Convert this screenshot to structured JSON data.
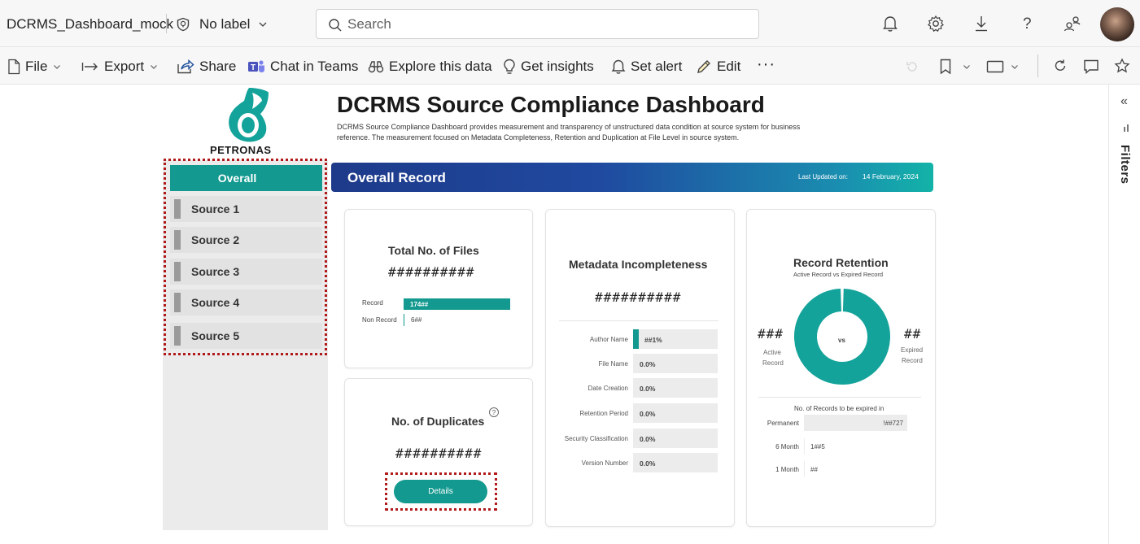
{
  "app": {
    "report_title": "DCRMS_Dashboard_mock",
    "sensitivity_label": "No label",
    "search_placeholder": "Search"
  },
  "toolbar": {
    "file": "File",
    "export": "Export",
    "share": "Share",
    "chat": "Chat in Teams",
    "explore": "Explore this data",
    "insights": "Get insights",
    "alert": "Set alert",
    "edit": "Edit",
    "more": "···"
  },
  "filters_pane": {
    "label": "Filters",
    "collapse_glyph": "«"
  },
  "brand": {
    "logo_text": "PETRONAS",
    "color": "#13998f"
  },
  "header": {
    "title": "DCRMS Source Compliance Dashboard",
    "description_1": "DCRMS Source Compliance Dashboard provides measurement and transparency of unstructured data condition at source system for business",
    "description_2": "reference. The measurement focused on Metadata Completeness, Retention and Duplication at File Level in source system."
  },
  "nav": {
    "items": [
      {
        "label": "Overall",
        "active": true
      },
      {
        "label": "Source 1",
        "active": false
      },
      {
        "label": "Source 2",
        "active": false
      },
      {
        "label": "Source 3",
        "active": false
      },
      {
        "label": "Source 4",
        "active": false
      },
      {
        "label": "Source 5",
        "active": false
      }
    ]
  },
  "banner": {
    "title": "Overall Record",
    "last_updated_label": "Last Updated on:",
    "last_updated_value": "14 February, 2024"
  },
  "total_files": {
    "title": "Total No. of Files",
    "value": "##########",
    "record_label": "Record",
    "record_value": "174##",
    "record_fraction": 0.96,
    "non_record_label": "Non Record",
    "non_record_value": "6##"
  },
  "duplicates": {
    "title": "No. of Duplicates",
    "value": "##########",
    "details_button": "Details",
    "help_glyph": "?"
  },
  "metadata": {
    "title": "Metadata Incompleteness",
    "value": "##########",
    "rows": [
      {
        "label": "Author Name",
        "value": "##1%",
        "fraction": 0.07
      },
      {
        "label": "File Name",
        "value": "0.0%",
        "fraction": 0
      },
      {
        "label": "Date Creation",
        "value": "0.0%",
        "fraction": 0
      },
      {
        "label": "Retention Period",
        "value": "0.0%",
        "fraction": 0
      },
      {
        "label": "Security Classification",
        "value": "0.0%",
        "fraction": 0
      },
      {
        "label": "Version Number",
        "value": "0.0%",
        "fraction": 0
      }
    ]
  },
  "retention": {
    "title": "Record Retention",
    "subtitle": "Active Record vs Expired Record",
    "active_value": "###",
    "active_label_1": "Active",
    "active_label_2": "Record",
    "expired_value": "##",
    "expired_label_1": "Expired",
    "expired_label_2": "Record",
    "center_label": "vs",
    "active_fraction": 0.99,
    "donut_color": "#13a39a",
    "expiry_title": "No. of Records to be expired in",
    "expiry_rows": [
      {
        "label": "Permanent",
        "value": "!##727",
        "fraction": 1.0
      },
      {
        "label": "6 Month",
        "value": "1##5",
        "fraction": 0.01
      },
      {
        "label": "1 Month",
        "value": "##",
        "fraction": 0.0
      }
    ]
  }
}
